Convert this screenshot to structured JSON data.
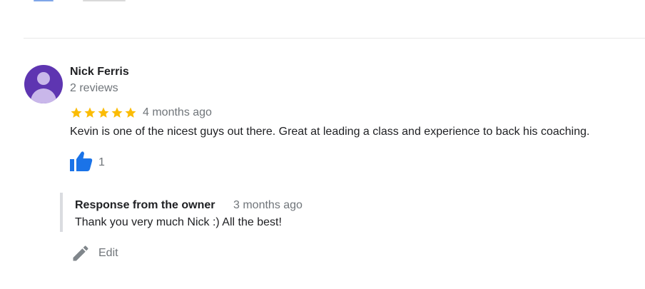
{
  "review": {
    "reviewer_name": "Nick Ferris",
    "reviewer_meta": "2 reviews",
    "rating": 5,
    "date": "4 months ago",
    "text": "Kevin is one of the nicest guys out there. Great at leading a class and experience to back his coaching.",
    "likes": "1"
  },
  "owner_response": {
    "label": "Response from the owner",
    "date": "3 months ago",
    "text": "Thank you very much Nick :) All the best!"
  },
  "actions": {
    "edit_label": "Edit"
  },
  "colors": {
    "star": "#fbbc04",
    "like_icon": "#1a73e8",
    "avatar_bg": "#5e35b1",
    "muted_text": "#70757a",
    "edit_icon": "#80868b"
  },
  "icons": {
    "avatar": "person-icon",
    "like": "thumbs-up-icon",
    "edit": "pencil-icon",
    "star": "star-icon"
  }
}
